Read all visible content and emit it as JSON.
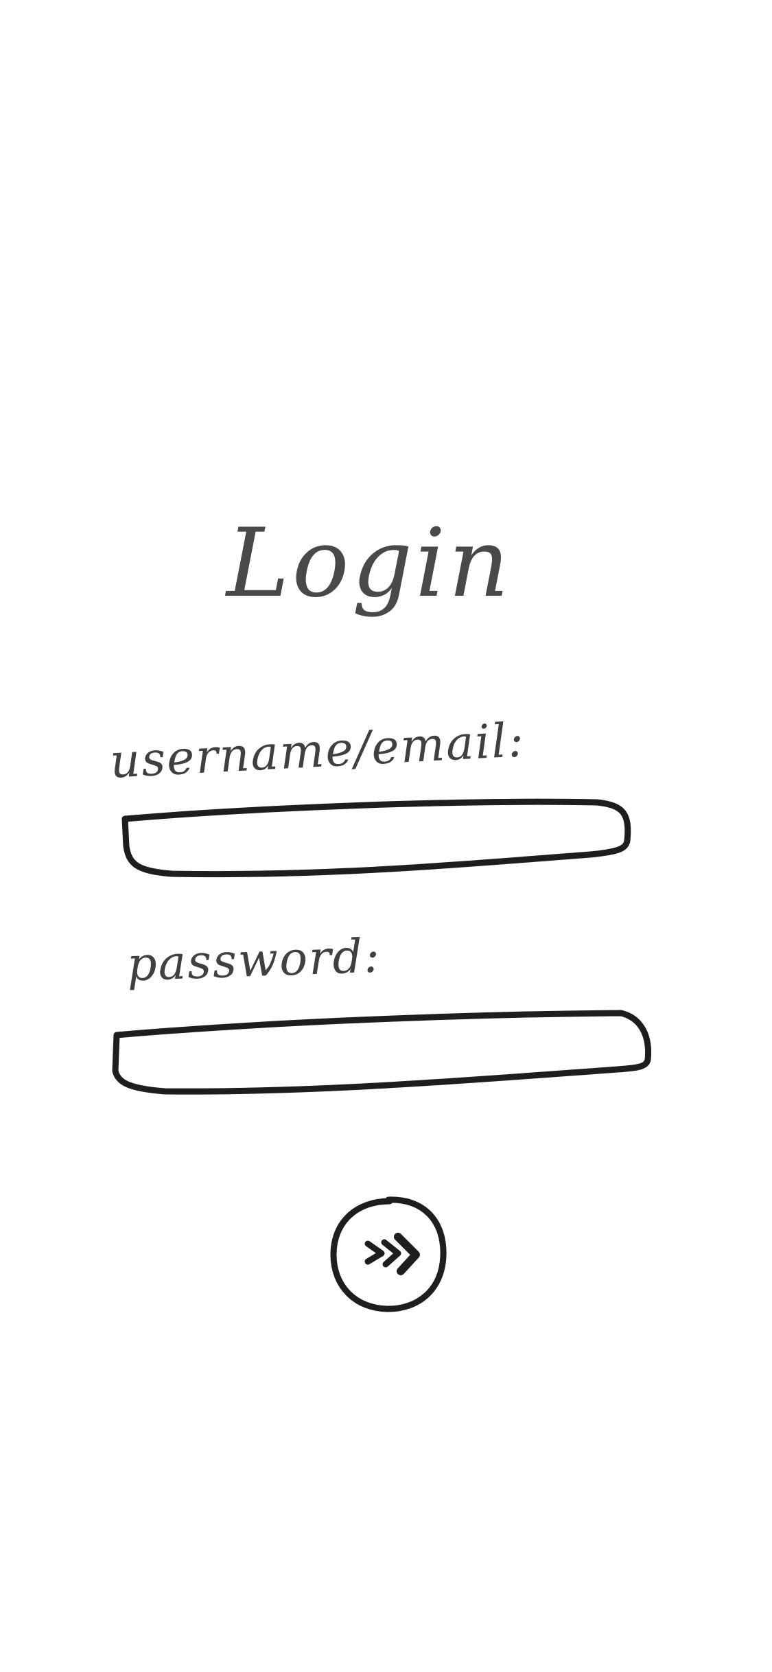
{
  "login": {
    "title": "Login",
    "username_label": "username/email:",
    "password_label": "password:",
    "username_value": "",
    "password_value": "",
    "submit_icon": "double-chevron-right-icon",
    "ink_color": "#1e1e1e"
  }
}
